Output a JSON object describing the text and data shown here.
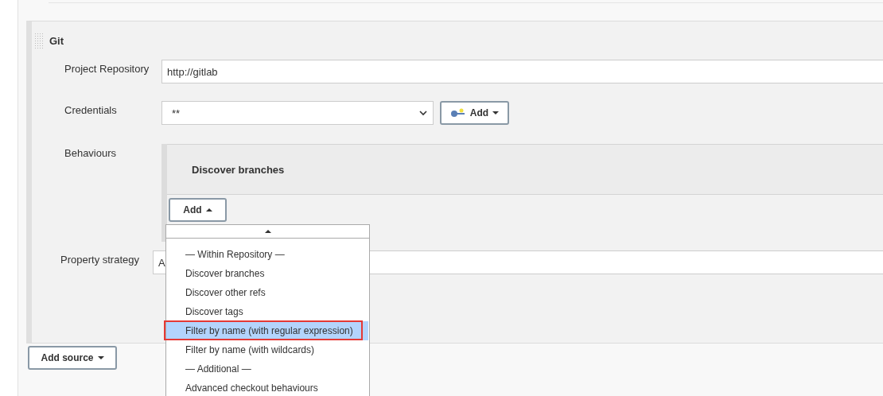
{
  "section": {
    "title": "Git"
  },
  "fields": [
    {
      "kind": "text",
      "label": "Project Repository",
      "value": "http://gitlab"
    },
    {
      "kind": "select",
      "label": "Credentials",
      "value": "**",
      "button": "Add"
    }
  ],
  "behaviours": {
    "label": "Behaviours",
    "items": [
      "Discover branches"
    ],
    "add_button": "Add"
  },
  "property_strategy": {
    "label": "Property strategy",
    "value": "A"
  },
  "add_source_button": "Add source",
  "dropdown": {
    "items": [
      {
        "kind": "header",
        "label": "— Within Repository —",
        "selected": false
      },
      {
        "kind": "option",
        "label": "Discover branches",
        "selected": false
      },
      {
        "kind": "option",
        "label": "Discover other refs",
        "selected": false
      },
      {
        "kind": "option",
        "label": "Discover tags",
        "selected": false
      },
      {
        "kind": "option",
        "label": "Filter by name (with regular expression)",
        "selected": true
      },
      {
        "kind": "option",
        "label": "Filter by name (with wildcards)",
        "selected": false
      },
      {
        "kind": "header",
        "label": "— Additional —",
        "selected": false
      },
      {
        "kind": "option",
        "label": "Advanced checkout behaviours",
        "selected": false
      }
    ]
  }
}
